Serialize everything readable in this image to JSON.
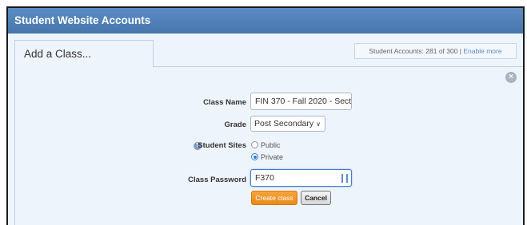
{
  "window": {
    "title": "Student Website Accounts"
  },
  "tab": {
    "label": "Add a Class..."
  },
  "accounts": {
    "text": "Student Accounts: 281 of 300 | ",
    "link": "Enable more"
  },
  "form": {
    "class_name": {
      "label": "Class Name",
      "value": "FIN 370 - Fall 2020 - Secti"
    },
    "grade": {
      "label": "Grade",
      "selected": "Post Secondary"
    },
    "student_sites": {
      "label": "Student Sites",
      "options": [
        {
          "label": "Public",
          "checked": false
        },
        {
          "label": "Private",
          "checked": true
        }
      ]
    },
    "class_password": {
      "label": "Class Password",
      "value": "F370"
    },
    "create_label": "Create class",
    "cancel_label": "Cancel"
  },
  "icons": {
    "close": "close-circle-icon",
    "help": "help-icon",
    "password": "password-manager-icon",
    "chevron": "chevron-down-icon"
  },
  "colors": {
    "titlebar": "#4f80b8",
    "panel": "#eef4fb",
    "create_button": "#f29a2e",
    "focus": "#3b7ed0"
  }
}
